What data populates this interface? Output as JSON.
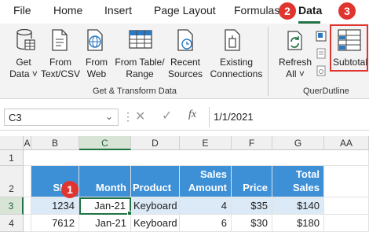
{
  "menu": {
    "tabs": [
      "File",
      "Home",
      "Insert",
      "Page Layout",
      "Formulas",
      "Data"
    ],
    "active": "Data"
  },
  "ribbon": {
    "get_data": {
      "line1": "Get",
      "line2": "Data ˅"
    },
    "from_text": {
      "line1": "From",
      "line2": "Text/CSV"
    },
    "from_web": {
      "line1": "From",
      "line2": "Web"
    },
    "from_table": {
      "line1": "From Table/",
      "line2": "Range"
    },
    "recent": {
      "line1": "Recent",
      "line2": "Sources"
    },
    "existing": {
      "line1": "Existing",
      "line2": "Connections"
    },
    "refresh": {
      "line1": "Refresh",
      "line2": "All ˅"
    },
    "subtotal": {
      "label": "Subtotal"
    },
    "group1_label": "Get & Transform Data",
    "group2_label": "QuerDutline"
  },
  "badges": {
    "b1": "1",
    "b2": "2",
    "b3": "3"
  },
  "formula_bar": {
    "name_box": "C3",
    "formula": "1/1/2021",
    "fx": "fx"
  },
  "grid": {
    "columns": [
      "A",
      "B",
      "C",
      "D",
      "E",
      "F",
      "G",
      "AA"
    ],
    "rows": [
      "1",
      "2",
      "3",
      "4"
    ],
    "header": {
      "sku": "SKU",
      "month": "Month",
      "product": "Product",
      "sales_amount_1": "Sales",
      "sales_amount_2": "Amount",
      "price": "Price",
      "total_1": "Total",
      "total_2": "Sales"
    },
    "data": [
      {
        "sku": "1234",
        "month": "Jan-21",
        "product": "Keyboard",
        "amount": "4",
        "price": "$35",
        "total": "$140"
      },
      {
        "sku": "7612",
        "month": "Jan-21",
        "product": "Keyboard",
        "amount": "6",
        "price": "$30",
        "total": "$180"
      }
    ]
  },
  "colors": {
    "accent": "#217346",
    "header_fill": "#3d8fd6",
    "badge": "#e0342f"
  }
}
